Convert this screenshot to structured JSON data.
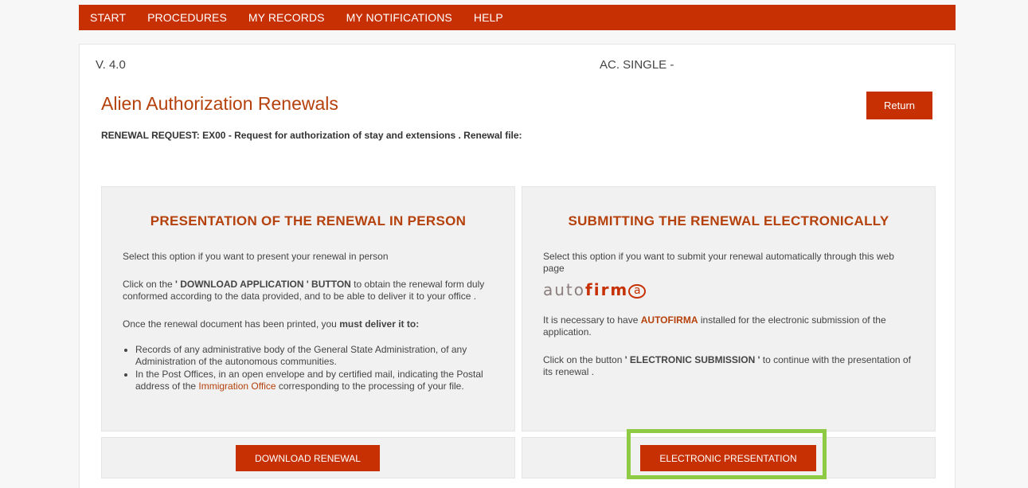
{
  "nav": {
    "items": [
      "START",
      "PROCEDURES",
      "MY RECORDS",
      "MY NOTIFICATIONS",
      "HELP"
    ]
  },
  "header": {
    "version": "V. 4.0",
    "single": "AC. SINGLE -",
    "title": "Alien Authorization Renewals",
    "return_label": "Return",
    "request": "RENEWAL REQUEST: EX00 - Request for authorization of stay and extensions . Renewal file:"
  },
  "in_person": {
    "title": "PRESENTATION OF THE RENEWAL IN PERSON",
    "intro": "Select this option if you want to present your renewal in person",
    "click_pre": "Click on the ",
    "click_bold": "' DOWNLOAD APPLICATION ' BUTTON",
    "click_post": " to obtain the renewal form duly conformed according to the data provided, and to be able to deliver it to your office .",
    "deliver_pre": "Once the renewal document has been printed, you ",
    "deliver_bold": "must deliver it to:",
    "bullet_1": "Records of any administrative body of the General State Administration, of any Administration of the autonomous communities.",
    "bullet_2_pre": "In the Post Offices, in an open envelope and by certified mail, indicating the Postal address of the ",
    "bullet_2_link": "Immigration Office",
    "bullet_2_post": " corresponding to the processing of your file.",
    "button_label": "DOWNLOAD RENEWAL"
  },
  "electronic": {
    "title": "SUBMITTING THE RENEWAL ELECTRONICALLY",
    "intro": "Select this option if you want to submit your renewal automatically through this web page",
    "logo_auto": "auto",
    "logo_firm": "firm",
    "logo_at": "a",
    "note_pre": "It is necessary to have ",
    "note_bold": "AUTOFIRMA",
    "note_post": " installed for the electronic submission of the application.",
    "click_pre": "Click on the button ",
    "click_bold": "' ELECTRONIC SUBMISSION '",
    "click_post": " to continue with the presentation of its renewal .",
    "button_label": "ELECTRONIC PRESENTATION"
  },
  "colors": {
    "brand": "#c63002",
    "title": "#b5410c",
    "highlight": "#8fca45"
  }
}
